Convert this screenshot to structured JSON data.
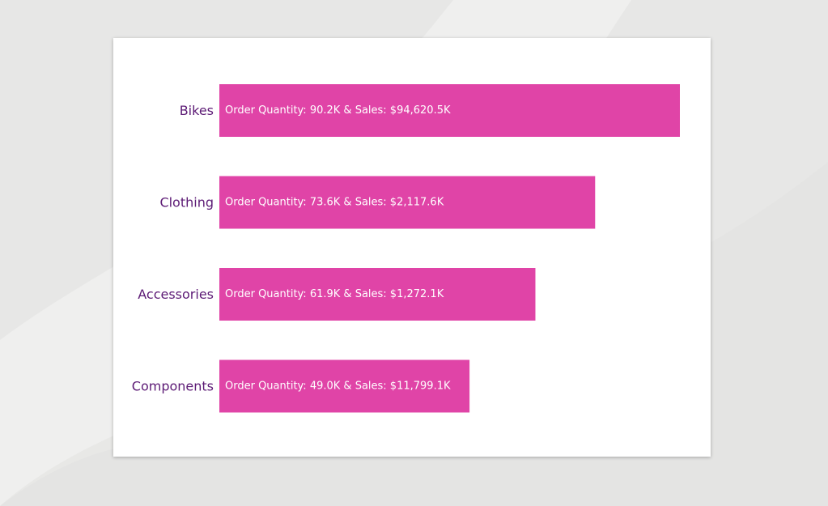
{
  "colors": {
    "bar": "#e044a7",
    "category_text": "#5c1a75",
    "data_label_text": "#ffffff",
    "background": "#e7e7e6",
    "card": "#ffffff"
  },
  "chart_data": {
    "type": "bar",
    "orientation": "horizontal",
    "categories": [
      "Bikes",
      "Clothing",
      "Accessories",
      "Components"
    ],
    "values": [
      90.2,
      73.6,
      61.9,
      49.0
    ],
    "sales": [
      "$94,620.5K",
      "$2,117.6K",
      "$1,272.1K",
      "$11,799.1K"
    ],
    "data_labels": [
      "Order Quantity: 90.2K & Sales: $94,620.5K",
      "Order Quantity: 73.6K & Sales: $2,117.6K",
      "Order Quantity: 61.9K & Sales: $1,272.1K",
      "Order Quantity: 49.0K & Sales: $11,799.1K"
    ],
    "xlim": [
      0,
      90.2
    ],
    "grid": false,
    "legend": "none"
  }
}
